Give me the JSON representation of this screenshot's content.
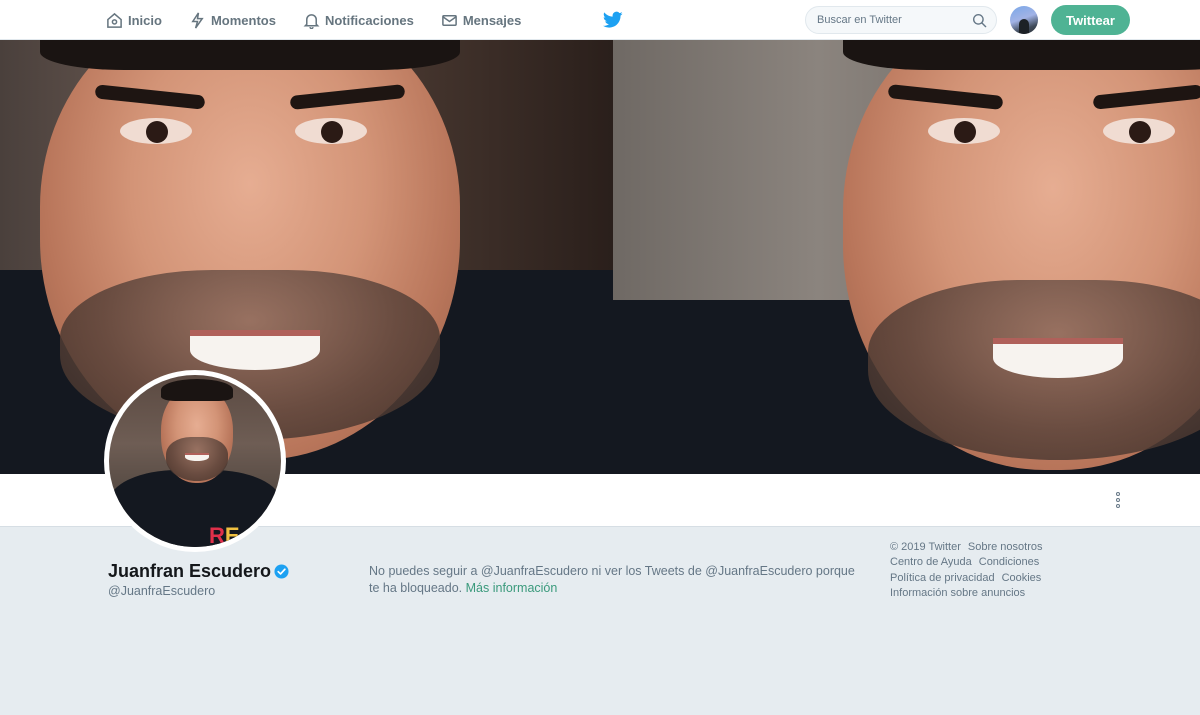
{
  "nav": {
    "items": [
      {
        "label": "Inicio",
        "icon": "home-icon"
      },
      {
        "label": "Momentos",
        "icon": "lightning-icon"
      },
      {
        "label": "Notificaciones",
        "icon": "bell-icon"
      },
      {
        "label": "Mensajes",
        "icon": "envelope-icon"
      }
    ],
    "search_placeholder": "Buscar en Twitter",
    "tweet_button": "Twittear"
  },
  "profile": {
    "name": "Juanfran Escudero",
    "handle": "@JuanfraEscudero",
    "verified": true
  },
  "blocked": {
    "message": "No puedes seguir a @JuanfraEscudero ni ver los Tweets de @JuanfraEscudero porque te ha bloqueado.",
    "link": "Más información"
  },
  "footer": {
    "links": [
      "© 2019 Twitter",
      "Sobre nosotros",
      "Centro de Ayuda",
      "Condiciones",
      "Política de privacidad",
      "Cookies",
      "Información sobre anuncios"
    ]
  },
  "colors": {
    "accent": "#4fb394",
    "link": "#3a9a7c",
    "twitter_blue": "#1da1f2",
    "background": "#e6ecf0"
  }
}
